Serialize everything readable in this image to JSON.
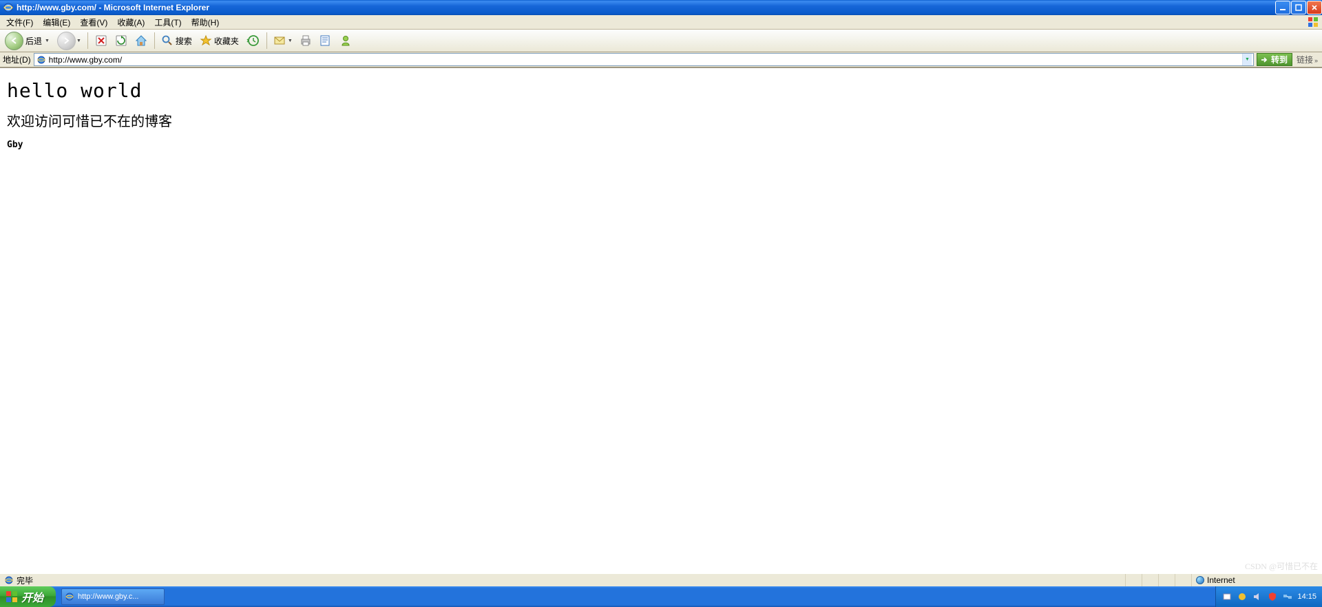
{
  "window": {
    "title": "http://www.gby.com/ - Microsoft Internet Explorer"
  },
  "menu": {
    "file": "文件(F)",
    "edit": "编辑(E)",
    "view": "查看(V)",
    "favorites": "收藏(A)",
    "tools": "工具(T)",
    "help": "帮助(H)"
  },
  "toolbar": {
    "back": "后退",
    "search": "搜索",
    "favorites": "收藏夹"
  },
  "address": {
    "label": "地址(D)",
    "url": "http://www.gby.com/",
    "go": "转到",
    "links": "链接"
  },
  "page": {
    "h1": "hello world",
    "h2": "欢迎访问可惜已不在的博客",
    "h4": "Gby"
  },
  "status": {
    "text": "完毕",
    "zone": "Internet"
  },
  "taskbar": {
    "start": "开始",
    "task1": "http://www.gby.c...",
    "clock": "14:15",
    "watermark": "CSDN @可惜已不在"
  }
}
